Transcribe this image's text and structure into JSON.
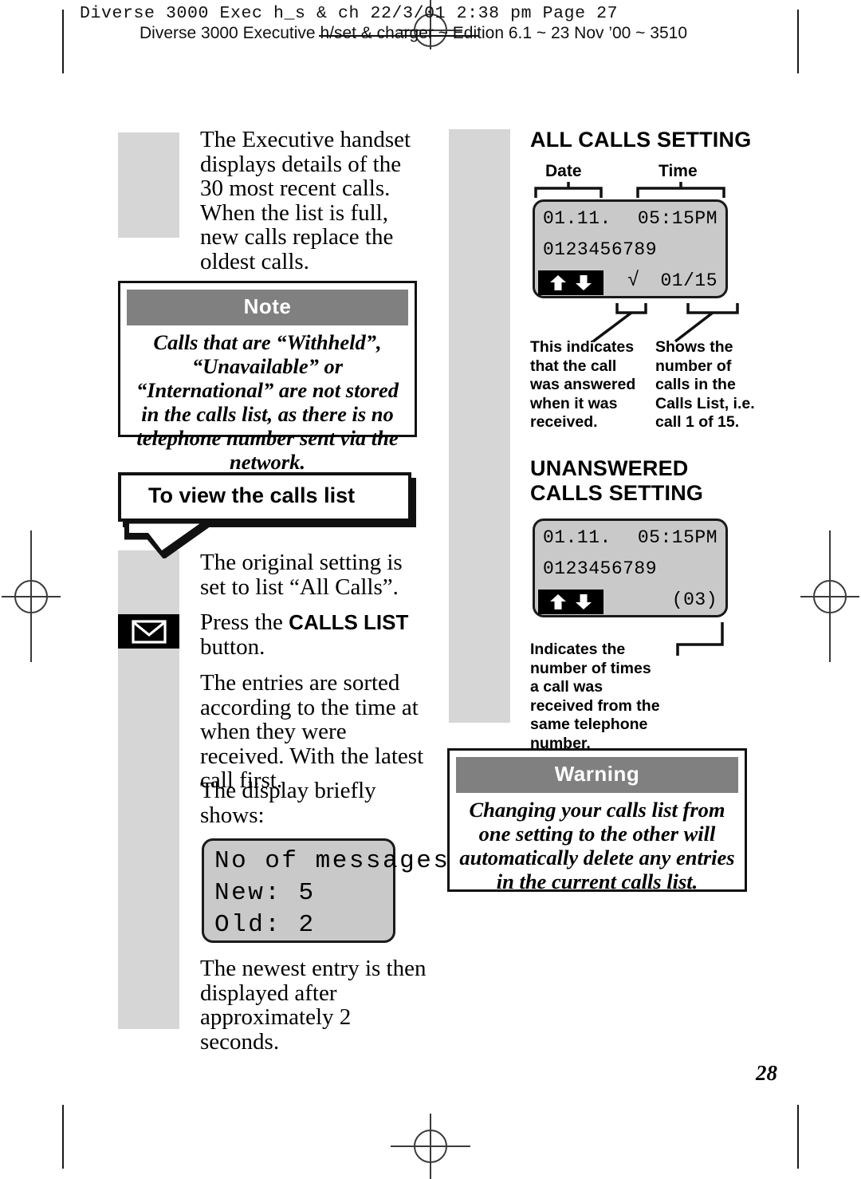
{
  "header": {
    "filename_line": "Diverse 3000 Exec h_s & ch  22/3/01  2:38 pm  Page 27",
    "edition_line": "Diverse 3000 Executive h/set & charger ~ Edition 6.1 ~ 23 Nov ’00 ~ 3510"
  },
  "left_column": {
    "intro_paragraph": "The Executive handset displays details of the 30 most recent calls. When the list is full, new calls replace the oldest calls.",
    "note_box": {
      "title": "Note",
      "body": "Calls that are “Withheld”, “Unavailable” or “International” are not stored in the calls list, as there is no telephone number sent via the network."
    },
    "banner_title": "To view the calls list",
    "step_original_setting": "The original setting is set to list “All Calls”.",
    "step_press_calls_list_pre": "Press the ",
    "step_press_calls_list_bold": "CALLS LIST",
    "step_press_calls_list_post": " button.",
    "key_icon": "envelope-icon",
    "step_entries_sorted": "The entries are sorted according to the time at when they were received. With the latest call first.",
    "step_display_briefly": "The display briefly shows:",
    "messages_display": {
      "line1": "No of messages",
      "line2": "New: 5",
      "line3": "Old: 2"
    },
    "step_newest_entry": "The newest entry is then displayed after approximately 2 seconds."
  },
  "right_column": {
    "all_calls": {
      "heading": "ALL CALLS SETTING",
      "bracket_label_date": "Date",
      "bracket_label_time": "Time",
      "display": {
        "date": "01.11.",
        "time": "05:15PM",
        "number": "0123456789",
        "tick": "√",
        "counter": "01/15",
        "scroll_icons": [
          "up-arrow-icon",
          "down-arrow-icon"
        ]
      },
      "note_tick": "This indicates that the call was answered when it was received.",
      "note_counter": "Shows the number of calls in the Calls List, i.e. call 1 of 15."
    },
    "unanswered_calls": {
      "heading": "UNANSWERED CALLS SETTING",
      "display": {
        "date": "01.11.",
        "time": "05:15PM",
        "number": "0123456789",
        "counter": "(03)",
        "scroll_icons": [
          "up-arrow-icon",
          "down-arrow-icon"
        ]
      },
      "note_counter": "Indicates the number of times a call was received from the same telephone number."
    },
    "warning_box": {
      "title": "Warning",
      "body": "Changing your calls list from one setting to the other will automatically delete any entries in the current calls list."
    }
  },
  "footer": {
    "page_number": "28"
  }
}
